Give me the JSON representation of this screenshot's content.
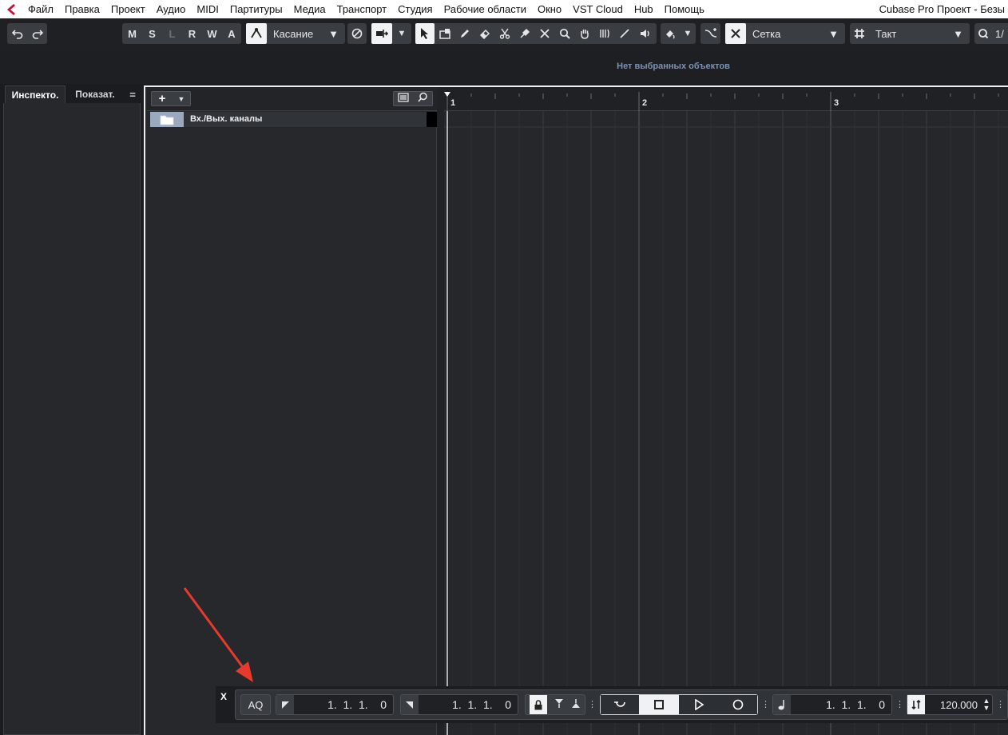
{
  "menubar": {
    "items": [
      "Файл",
      "Правка",
      "Проект",
      "Аудио",
      "MIDI",
      "Партитуры",
      "Медиа",
      "Транспорт",
      "Студия",
      "Рабочие области",
      "Окно",
      "VST Cloud",
      "Hub",
      "Помощь"
    ],
    "window_title": "Cubase Pro Проект - Безы"
  },
  "toolbar": {
    "state_buttons": [
      "M",
      "S",
      "L",
      "R",
      "W",
      "A"
    ],
    "automation_mode": "Касание",
    "snap_type": "Сетка",
    "grid_type": "Такт",
    "quantize_partial": "1/"
  },
  "infoline": {
    "message": "Нет выбранных объектов"
  },
  "left_zone": {
    "tabs": [
      {
        "label": "Инспекто.",
        "active": true
      },
      {
        "label": "Показат.",
        "active": false
      }
    ],
    "menu_glyph": "="
  },
  "tracklist": {
    "add_button": "+",
    "tracks": [
      {
        "name": "Вх./Вых. каналы"
      }
    ]
  },
  "ruler": {
    "bars": [
      "1",
      "2",
      "3"
    ]
  },
  "transport": {
    "close_label": "X",
    "aq_label": "AQ",
    "left_locator": "1.  1.  1.    0",
    "right_locator": "1.  1.  1.    0",
    "position": "1.  1.  1.    0",
    "tempo": "120.000"
  },
  "colors": {
    "accent_logo": "#c8102e",
    "annotation_arrow": "#e8392e",
    "info_text": "#7b93b3",
    "track_folder": "#9aa9bd"
  }
}
